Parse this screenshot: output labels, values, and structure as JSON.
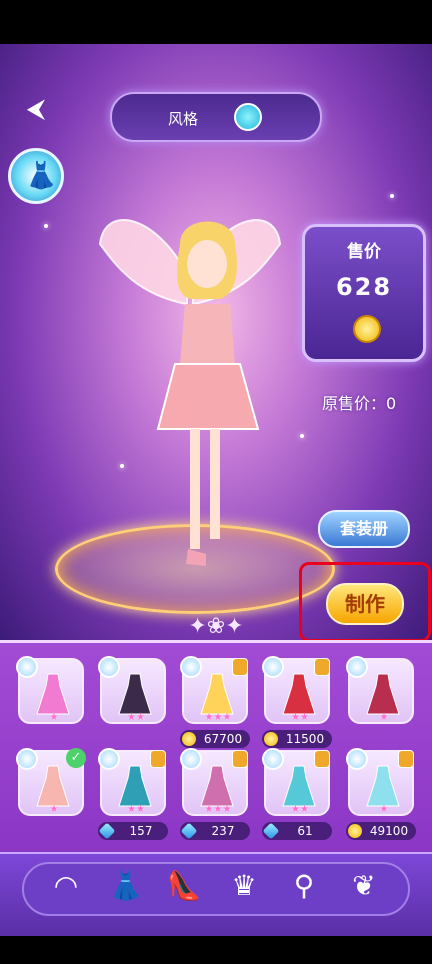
{
  "header": {
    "title": "风格"
  },
  "price_panel": {
    "title": "售价",
    "value": "628",
    "original_price": "原售价：0"
  },
  "buttons": {
    "outfit_book": "套装册",
    "craft": "制作"
  },
  "items": [
    {
      "name": "pink-princess-dress",
      "stars": "★",
      "cost": null
    },
    {
      "name": "black-white-dress",
      "stars": "★★",
      "cost": null
    },
    {
      "name": "yellow-maid-dress",
      "stars": "★★★",
      "cost": {
        "type": "coin",
        "value": "67700"
      }
    },
    {
      "name": "red-gothic-dress",
      "stars": "★★",
      "cost": {
        "type": "coin",
        "value": "11500"
      }
    },
    {
      "name": "red-ball-gown",
      "stars": "★",
      "cost": null
    },
    {
      "name": "peach-tulle-dress",
      "stars": "★",
      "cost": null
    },
    {
      "name": "blue-feather-dress",
      "stars": "★★",
      "cost": {
        "type": "diamond",
        "value": "157"
      }
    },
    {
      "name": "pink-lolita-dress",
      "stars": "★★★",
      "cost": {
        "type": "diamond",
        "value": "237"
      }
    },
    {
      "name": "aqua-mermaid-gown",
      "stars": "★★",
      "cost": {
        "type": "diamond",
        "value": "61"
      }
    },
    {
      "name": "blue-fairy-gown",
      "stars": "★",
      "cost": {
        "type": "coin",
        "value": "49100"
      }
    }
  ],
  "nav": [
    "hair-icon",
    "dress-icon",
    "shoe-icon",
    "headwear-icon",
    "wand-icon",
    "wings-icon"
  ],
  "colors": {
    "panel": "#9a44d0",
    "price_panel": "#5b32a8",
    "craft_highlight": "#e8001e"
  }
}
